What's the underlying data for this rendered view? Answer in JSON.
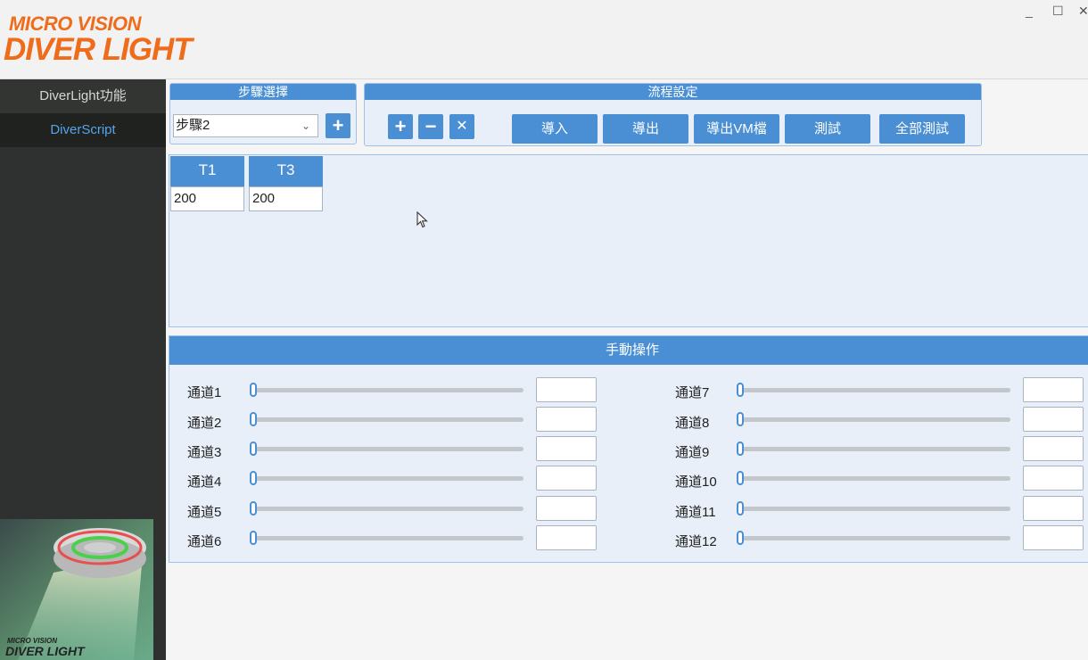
{
  "brand": {
    "top": "MICRO VISION",
    "main": "DIVER LIGHT",
    "small_top": "MICRO VISION",
    "small_main": "DIVER LIGHT"
  },
  "window_controls": {
    "minimize": "_",
    "maximize": "☐",
    "close": "✕"
  },
  "sidebar": {
    "items": [
      {
        "label": "DiverLight功能"
      },
      {
        "label": "DiverScript"
      }
    ]
  },
  "step": {
    "title": "步驟選擇",
    "selected": "步驟2"
  },
  "flow": {
    "title": "流程設定",
    "icon_buttons": [
      {
        "icon": "plus-icon",
        "glyph": "+"
      },
      {
        "icon": "minus-icon",
        "glyph": "−"
      },
      {
        "icon": "close-icon",
        "glyph": "✕"
      }
    ],
    "buttons": [
      "導入",
      "導出",
      "導出VM檔",
      "測試",
      "全部測試"
    ]
  },
  "sequence": {
    "columns": [
      {
        "header": "T1",
        "value": "200"
      },
      {
        "header": "T3",
        "value": "200"
      }
    ]
  },
  "manual": {
    "title": "手動操作",
    "channels_left": [
      "通道1",
      "通道2",
      "通道3",
      "通道4",
      "通道5",
      "通道6"
    ],
    "channels_right": [
      "通道7",
      "通道8",
      "通道9",
      "通道10",
      "通道11",
      "通道12"
    ]
  },
  "colors": {
    "accent": "#4a8fd4",
    "sidebar": "#2e312f",
    "brand": "#ef6c1a"
  }
}
